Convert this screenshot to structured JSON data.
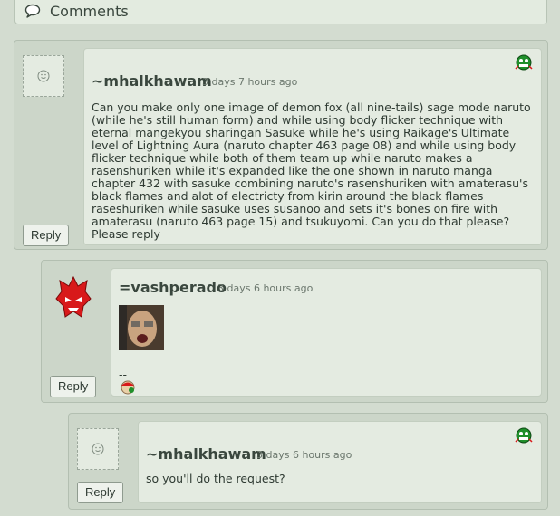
{
  "header": {
    "title": "Comments"
  },
  "comments": [
    {
      "username": "~mhalkhawam",
      "timestamp": "3 days 7 hours ago",
      "text": "Can you make only one image of demon fox (all nine-tails) sage mode naruto (while he's still human form) and while using body flicker technique with eternal mangekyou sharingan Sasuke while he's using Raikage's Ultimate level of Lightning Aura (naruto chapter 463 page 08) and while using body flicker technique while both of them team up while naruto makes a rasenshuriken while it's expanded like the one shown in naruto manga chapter 432 with sasuke combining naruto's rasenshuriken with amaterasu's black flames and alot of electricty from kirin around the black flames raseshuriken while sasuke uses susanoo and sets it's bones on fire with amaterasu (naruto 463 page 15) and tsukuyomi. Can you do that please? Please reply",
      "reply_label": "Reply"
    },
    {
      "username": "=vashperado",
      "timestamp": "3 days 6 hours ago",
      "signature": "--",
      "reply_label": "Reply"
    },
    {
      "username": "~mhalkhawam",
      "timestamp": "3 days 6 hours ago",
      "text": "so you'll do the request?",
      "reply_label": "Reply"
    }
  ],
  "colors": {
    "page_bg": "#d3dcd0",
    "card_bg": "#e4ebe1",
    "avatar_red": "#d8191a",
    "badge_green": "#1f8f2a"
  },
  "icons": {
    "header": "speech-bubble-icon",
    "empty_avatar": "smiley-icon",
    "badge": "green-alien-badge-icon",
    "red_avatar": "red-demon-avatar",
    "signature_badge": "mini-avatar-icon"
  }
}
